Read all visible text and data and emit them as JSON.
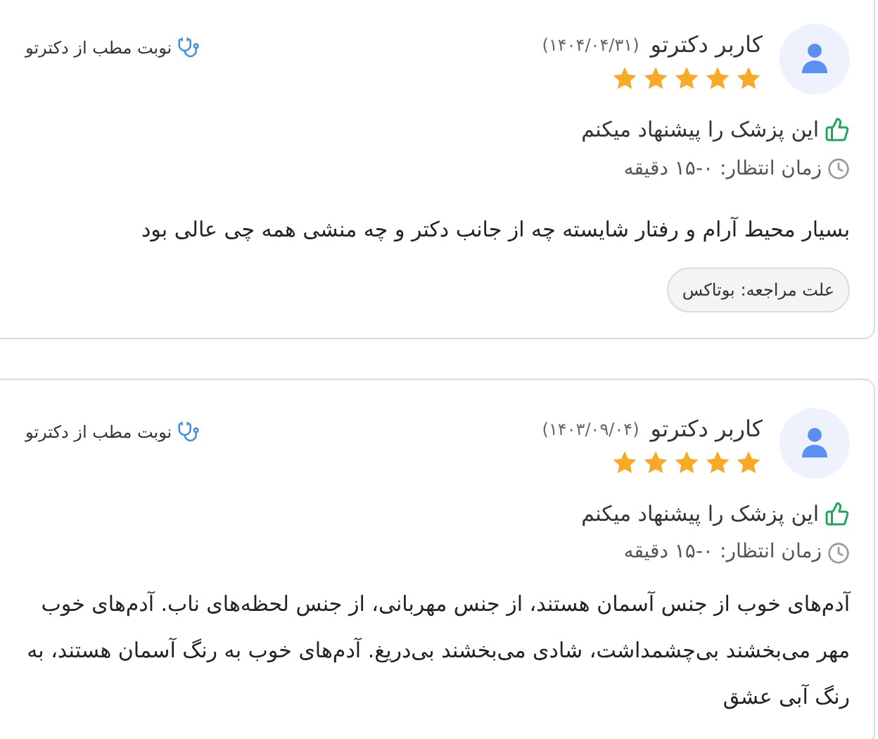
{
  "reviews": [
    {
      "user": "کاربر دکترتو",
      "date": "(۱۴۰۴/۰۴/۳۱)",
      "stars": 5,
      "source": "نوبت مطب از دکترتو",
      "recommend": "این پزشک را پیشنهاد میکنم",
      "wait": "زمان انتظار: ۰-۱۵ دقیقه",
      "comment": "بسیار محیط آرام و رفتار شایسته چه از جانب دکتر و چه منشی همه چی عالی بود",
      "reason": "علت مراجعه: بوتاکس"
    },
    {
      "user": "کاربر دکترتو",
      "date": "(۱۴۰۳/۰۹/۰۴)",
      "stars": 5,
      "source": "نوبت مطب از دکترتو",
      "recommend": "این پزشک را پیشنهاد میکنم",
      "wait": "زمان انتظار: ۰-۱۵ دقیقه",
      "comment": "آدم‌های خوب از جنس آسمان هستند، از جنس مهربانی، از جنس لحظه‌های ناب. آدم‌های خوب مهر می‌بخشند بی‌چشمداشت، شادی می‌بخشند بی‌دریغ. آدم‌های خوب به رنگ آسمان هستند، به رنگ آبی عشق"
    }
  ]
}
